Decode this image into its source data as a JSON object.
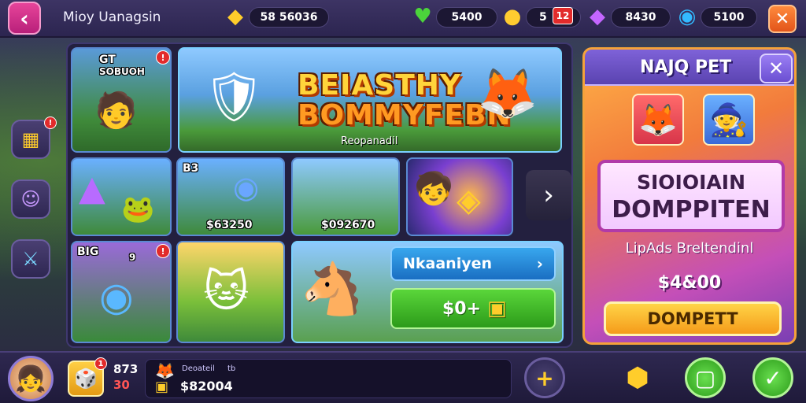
{
  "header": {
    "back_icon": "chevron-left-icon",
    "title": "Mioy Uanagsin",
    "gold": "58 56036",
    "gems": "5400",
    "coins_count": "5",
    "coins_badge": "12",
    "crystals": "8430",
    "energy": "5100",
    "close_glyph": "✕"
  },
  "side_buttons": [
    {
      "name": "chest-icon",
      "glyph": "▦",
      "badge": "!"
    },
    {
      "name": "character-icon",
      "glyph": "☺"
    },
    {
      "name": "sword-icon",
      "glyph": "⚔"
    }
  ],
  "tiles": {
    "t1_label_a": "GT",
    "t1_label_b": "SOBUOH",
    "t1_badge": "!",
    "banner_title_1": "BEIASTHY",
    "banner_title_2": "BOMMYFEBN",
    "banner_sub": "Reopanadil",
    "t3_label": "B3",
    "t3_price": "$63250",
    "t4_price": "$092670",
    "t6_label": "BIG",
    "t6_badge": "!",
    "t6_label_b": "9",
    "action_blue": "Nkaaniyen",
    "action_green": "$0+"
  },
  "pet_panel": {
    "title": "NAJQ PET",
    "close_glyph": "✕",
    "name_line1": "SIOIOIAIN",
    "name_line2": "DOMPPITEN",
    "description": "LipAds Breltendinl",
    "price": "$4&00",
    "buy_label": "DOMPETT"
  },
  "footer": {
    "stat_top": "873",
    "stat_bottom": "30",
    "level_badge": "1",
    "info_label_a": "Deoateil",
    "info_label_b": "tb",
    "info_value": "$82004",
    "plus_glyph": "+",
    "shield_glyph": "⬢",
    "green_glyph": "▢",
    "check_glyph": "✓"
  },
  "colors": {
    "accent_pink": "#e7449a",
    "accent_orange": "#f27b3c",
    "accent_purple": "#7a3fb3",
    "accent_green": "#2c9b1a",
    "accent_blue": "#1a6ec2"
  }
}
